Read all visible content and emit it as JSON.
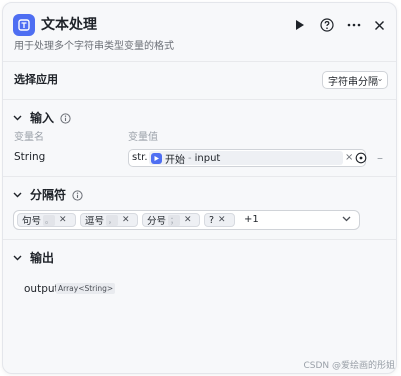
{
  "header": {
    "title": "文本处理",
    "subtitle": "用于处理多个字符串类型变量的格式",
    "icons": [
      "text-node-icon",
      "play-icon",
      "help-icon",
      "more-icon",
      "close-icon"
    ]
  },
  "app_select": {
    "label": "选择应用",
    "value": "字符串分隔"
  },
  "input_section": {
    "title": "输入",
    "col_name": "变量名",
    "col_value": "变量值",
    "row": {
      "name": "String",
      "type_tag": "str.",
      "ref_node": "开始",
      "ref_var": "input"
    }
  },
  "separator_section": {
    "title": "分隔符",
    "tags": [
      {
        "label": "句号",
        "symbol": "。"
      },
      {
        "label": "逗号",
        "symbol": "，"
      },
      {
        "label": "分号",
        "symbol": "；"
      },
      {
        "label": "?",
        "symbol": ""
      }
    ],
    "more": "+1"
  },
  "output_section": {
    "title": "输出",
    "name": "output",
    "type": "Array<String>"
  },
  "watermark": "CSDN @爱绘画的彤姐",
  "colors": {
    "accent": "#4e6ef2",
    "panel_bg": "#f7f8fa",
    "border": "#d0d3d8"
  }
}
